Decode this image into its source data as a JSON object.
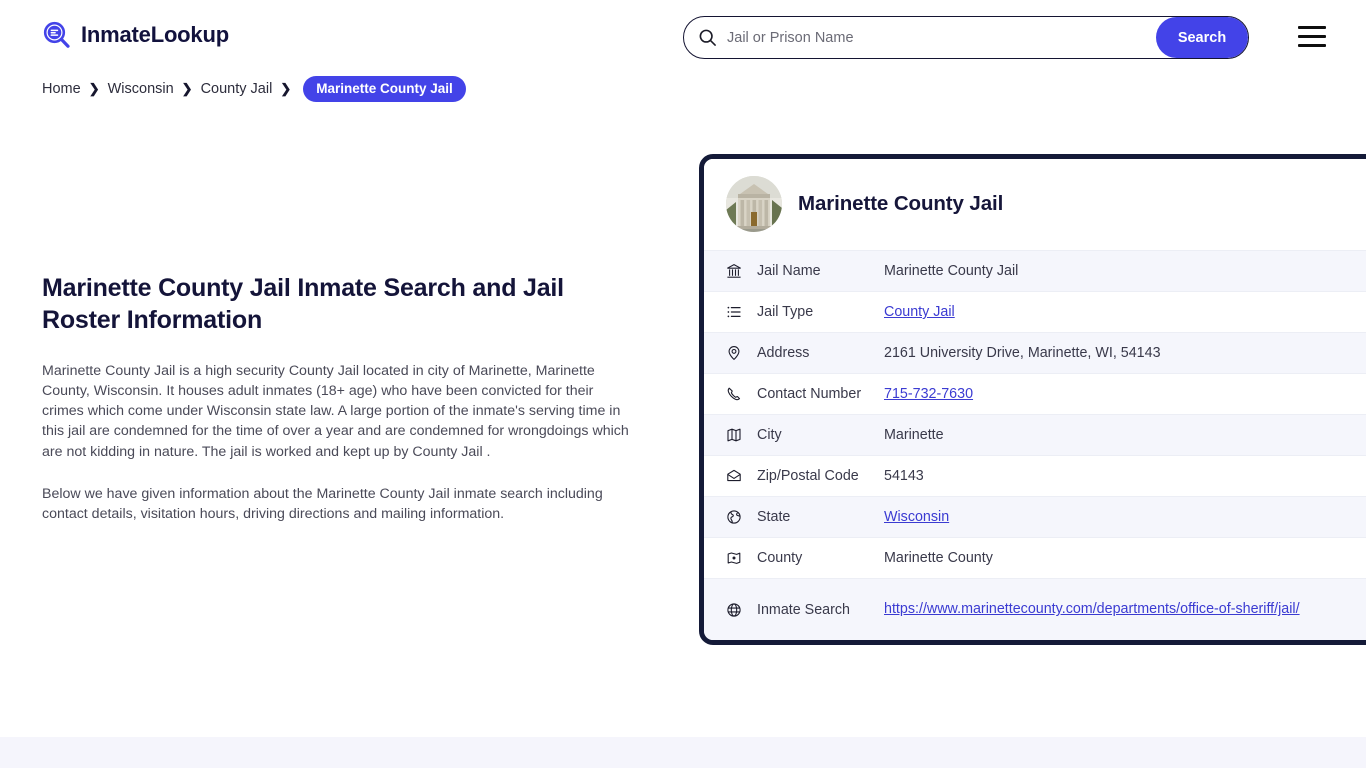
{
  "header": {
    "brand_name": "InmateLookup",
    "brand_logo_icon": "magnifier-list-logo-icon",
    "search": {
      "placeholder": "Jail or Prison Name",
      "value": "",
      "icon": "search-icon",
      "button_label": "Search"
    },
    "menu_icon": "hamburger-menu-icon"
  },
  "breadcrumb": {
    "items": [
      {
        "label": "Home",
        "current": false
      },
      {
        "label": "Wisconsin",
        "current": false
      },
      {
        "label": "County Jail",
        "current": false
      },
      {
        "label": "Marinette County Jail",
        "current": true
      }
    ],
    "separator": "❯"
  },
  "main": {
    "title": "Marinette County Jail Inmate Search and Jail Roster Information",
    "paragraph_1": "Marinette County Jail is a high security County Jail located in city of Marinette, Marinette County, Wisconsin. It houses adult inmates (18+ age) who have been convicted for their crimes which come under Wisconsin state law. A large portion of the inmate's serving time in this jail are condemned for the time of over a year and are condemned for wrongdoings which are not kidding in nature. The jail is worked and kept up by County Jail .",
    "paragraph_2": "Below we have given information about the Marinette County Jail inmate search including contact details, visitation hours, driving directions and mailing information."
  },
  "card": {
    "title": "Marinette County Jail",
    "avatar_icon": "courthouse-photo-avatar",
    "rows": [
      {
        "icon": "bank-icon",
        "label": "Jail Name",
        "value": "Marinette County Jail",
        "link": false
      },
      {
        "icon": "list-icon",
        "label": "Jail Type",
        "value": "County Jail",
        "link": true
      },
      {
        "icon": "map-pin-icon",
        "label": "Address",
        "value": "2161 University Drive, Marinette, WI, 54143",
        "link": false
      },
      {
        "icon": "phone-icon",
        "label": "Contact Number",
        "value": "715-732-7630",
        "link": true
      },
      {
        "icon": "map-icon",
        "label": "City",
        "value": "Marinette",
        "link": false
      },
      {
        "icon": "envelope-icon",
        "label": "Zip/Postal Code",
        "value": "54143",
        "link": false
      },
      {
        "icon": "globe-americas-icon",
        "label": "State",
        "value": "Wisconsin",
        "link": true
      },
      {
        "icon": "map-marker-area-icon",
        "label": "County",
        "value": "Marinette County",
        "link": false
      },
      {
        "icon": "globe-icon",
        "label": "Inmate Search",
        "value": "https://www.marinettecounty.com/departments/office-of-sheriff/jail/",
        "link": true
      }
    ]
  },
  "colors": {
    "accent": "#4343e8",
    "link": "#3b3bd2",
    "card_border": "#141a38",
    "row_alt_bg": "#f5f6fc",
    "footer_band": "#f5f5fc",
    "heading": "#141439",
    "body_text": "#4a4a58"
  }
}
